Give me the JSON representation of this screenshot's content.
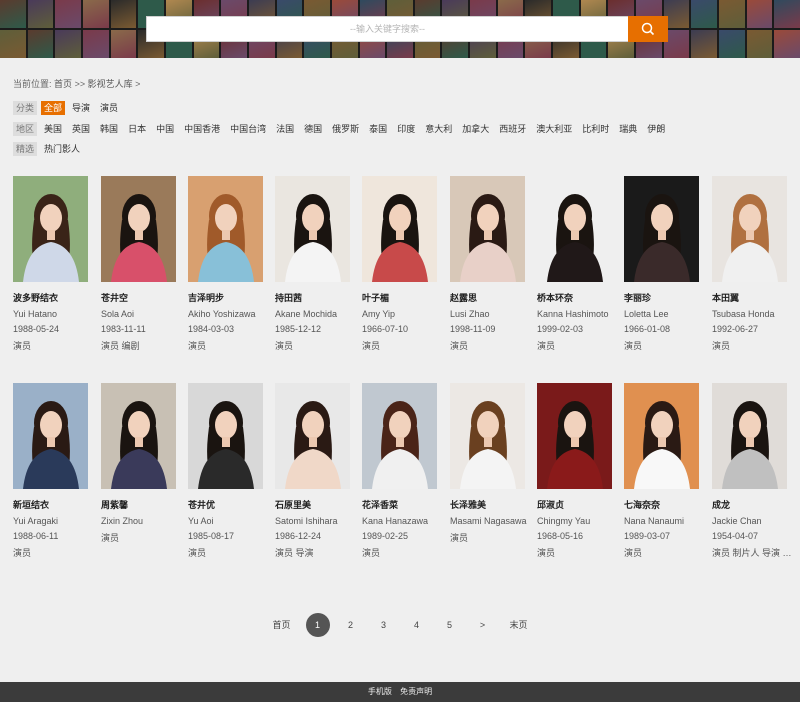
{
  "search": {
    "placeholder": "--输入关键字搜索--"
  },
  "breadcrumb": {
    "prefix": "当前位置:",
    "home": "首页",
    "sep1": ">>",
    "current": "影视艺人库",
    "sep2": ">"
  },
  "filters": {
    "category": {
      "label": "分类",
      "options": [
        "全部",
        "导演",
        "演员"
      ],
      "active": 0
    },
    "region": {
      "label": "地区",
      "options": [
        "美国",
        "英国",
        "韩国",
        "日本",
        "中国",
        "中国香港",
        "中国台湾",
        "法国",
        "德国",
        "俄罗斯",
        "泰国",
        "印度",
        "意大利",
        "加拿大",
        "西班牙",
        "澳大利亚",
        "比利时",
        "瑞典",
        "伊朗"
      ]
    },
    "featured": {
      "label": "精选",
      "options": [
        "热门影人"
      ]
    }
  },
  "people": [
    {
      "name": "波多野结衣",
      "en": "Yui Hatano",
      "date": "1988-05-24",
      "role": "演员"
    },
    {
      "name": "苍井空",
      "en": "Sola Aoi",
      "date": "1983-11-11",
      "role": "演员 编剧"
    },
    {
      "name": "吉泽明步",
      "en": "Akiho Yoshizawa",
      "date": "1984-03-03",
      "role": "演员"
    },
    {
      "name": "持田茜",
      "en": "Akane Mochida",
      "date": "1985-12-12",
      "role": "演员"
    },
    {
      "name": "叶子楣",
      "en": "Amy Yip",
      "date": "1966-07-10",
      "role": "演员"
    },
    {
      "name": "赵露思",
      "en": "Lusi Zhao",
      "date": "1998-11-09",
      "role": "演员"
    },
    {
      "name": "桥本环奈",
      "en": "Kanna Hashimoto",
      "date": "1999-02-03",
      "role": "演员"
    },
    {
      "name": "李丽珍",
      "en": "Loletta Lee",
      "date": "1966-01-08",
      "role": "演员"
    },
    {
      "name": "本田翼",
      "en": "Tsubasa Honda",
      "date": "1992-06-27",
      "role": "演员"
    },
    {
      "name": "新垣结衣",
      "en": "Yui Aragaki",
      "date": "1988-06-11",
      "role": "演员"
    },
    {
      "name": "周紫馨",
      "en": "Zixin Zhou",
      "date": "",
      "role": "演员"
    },
    {
      "name": "苍井优",
      "en": "Yu Aoi",
      "date": "1985-08-17",
      "role": "演员"
    },
    {
      "name": "石原里美",
      "en": "Satomi Ishihara",
      "date": "1986-12-24",
      "role": "演员 导演"
    },
    {
      "name": "花泽香菜",
      "en": "Kana Hanazawa",
      "date": "1989-02-25",
      "role": "演员"
    },
    {
      "name": "长泽雅美",
      "en": "Masami Nagasawa",
      "date": "",
      "role": "演员"
    },
    {
      "name": "邱淑贞",
      "en": "Chingmy Yau",
      "date": "1968-05-16",
      "role": "演员"
    },
    {
      "name": "七海奈奈",
      "en": "Nana Nanaumi",
      "date": "1989-03-07",
      "role": "演员"
    },
    {
      "name": "成龙",
      "en": "Jackie Chan",
      "date": "1954-04-07",
      "role": "演员 制片人 导演 编剧"
    }
  ],
  "pagination": {
    "first": "首页",
    "pages": [
      "1",
      "2",
      "3",
      "4",
      "5"
    ],
    "active": 0,
    "next": ">",
    "last": "末页"
  },
  "footer": {
    "mobile": "手机版",
    "disclaimer": "免责声明"
  },
  "colors": {
    "accent": "#e76f00",
    "active_page": "#555555",
    "footer": "#3b3b3b"
  }
}
